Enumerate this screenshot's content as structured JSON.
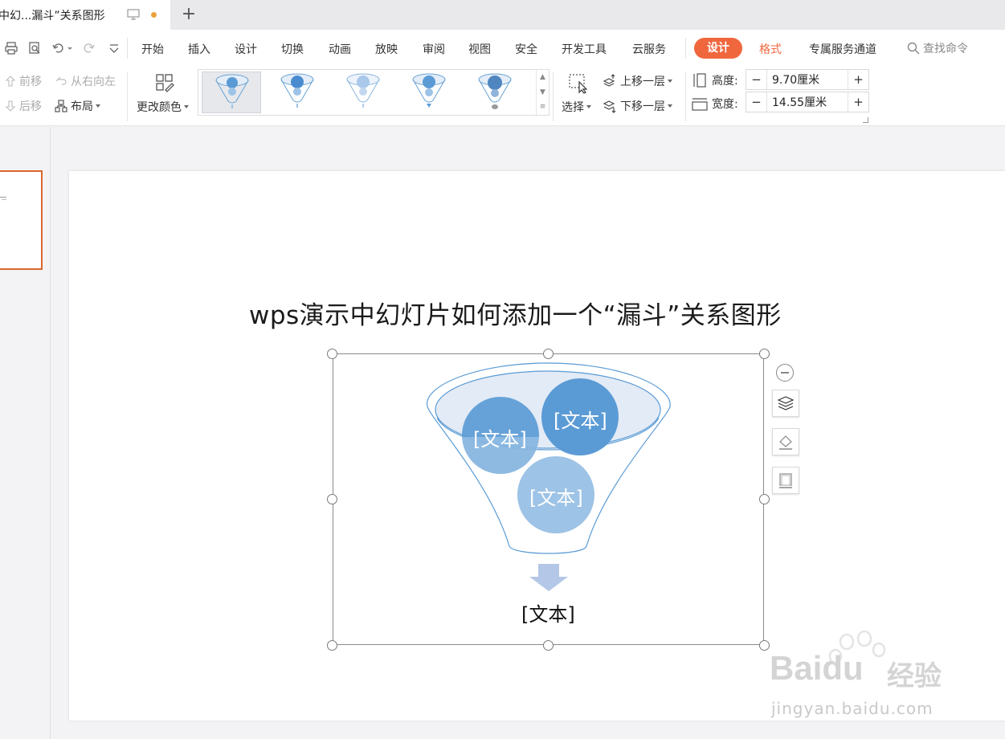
{
  "tab": {
    "title": "中幻...漏斗”关系图形",
    "add": "+"
  },
  "menu": {
    "items": [
      "开始",
      "插入",
      "设计",
      "切换",
      "动画",
      "放映",
      "审阅",
      "视图",
      "安全",
      "开发工具",
      "云服务"
    ],
    "design": "设计",
    "format": "格式",
    "service": "专属服务通道",
    "search": "查找命令"
  },
  "ribbon": {
    "forward": "前移",
    "backward": "后移",
    "rtl": "从右向左",
    "layout": "布局",
    "change_color": "更改颜色",
    "select": "选择",
    "bring_forward": "上移一层",
    "send_backward": "下移一层",
    "height_label": "高度:",
    "height_value": "9.70厘米",
    "width_label": "宽度:",
    "width_value": "14.55厘米",
    "minus": "−",
    "plus": "+"
  },
  "slide": {
    "title": "wps演示中幻灯片如何添加一个“漏斗”关系图形",
    "nodes": [
      "[文本]",
      "[文本]",
      "[文本]"
    ],
    "output": "[文本]"
  },
  "watermark": {
    "brand": "Bai",
    "brand2": "du",
    "product": "经验",
    "url": "jingyan.baidu.com"
  },
  "colors": {
    "accent": "#f0673e",
    "node_dark": "#5b9bd5",
    "node_light": "#9dc3e6",
    "funnel_line": "#6aa3d5"
  }
}
